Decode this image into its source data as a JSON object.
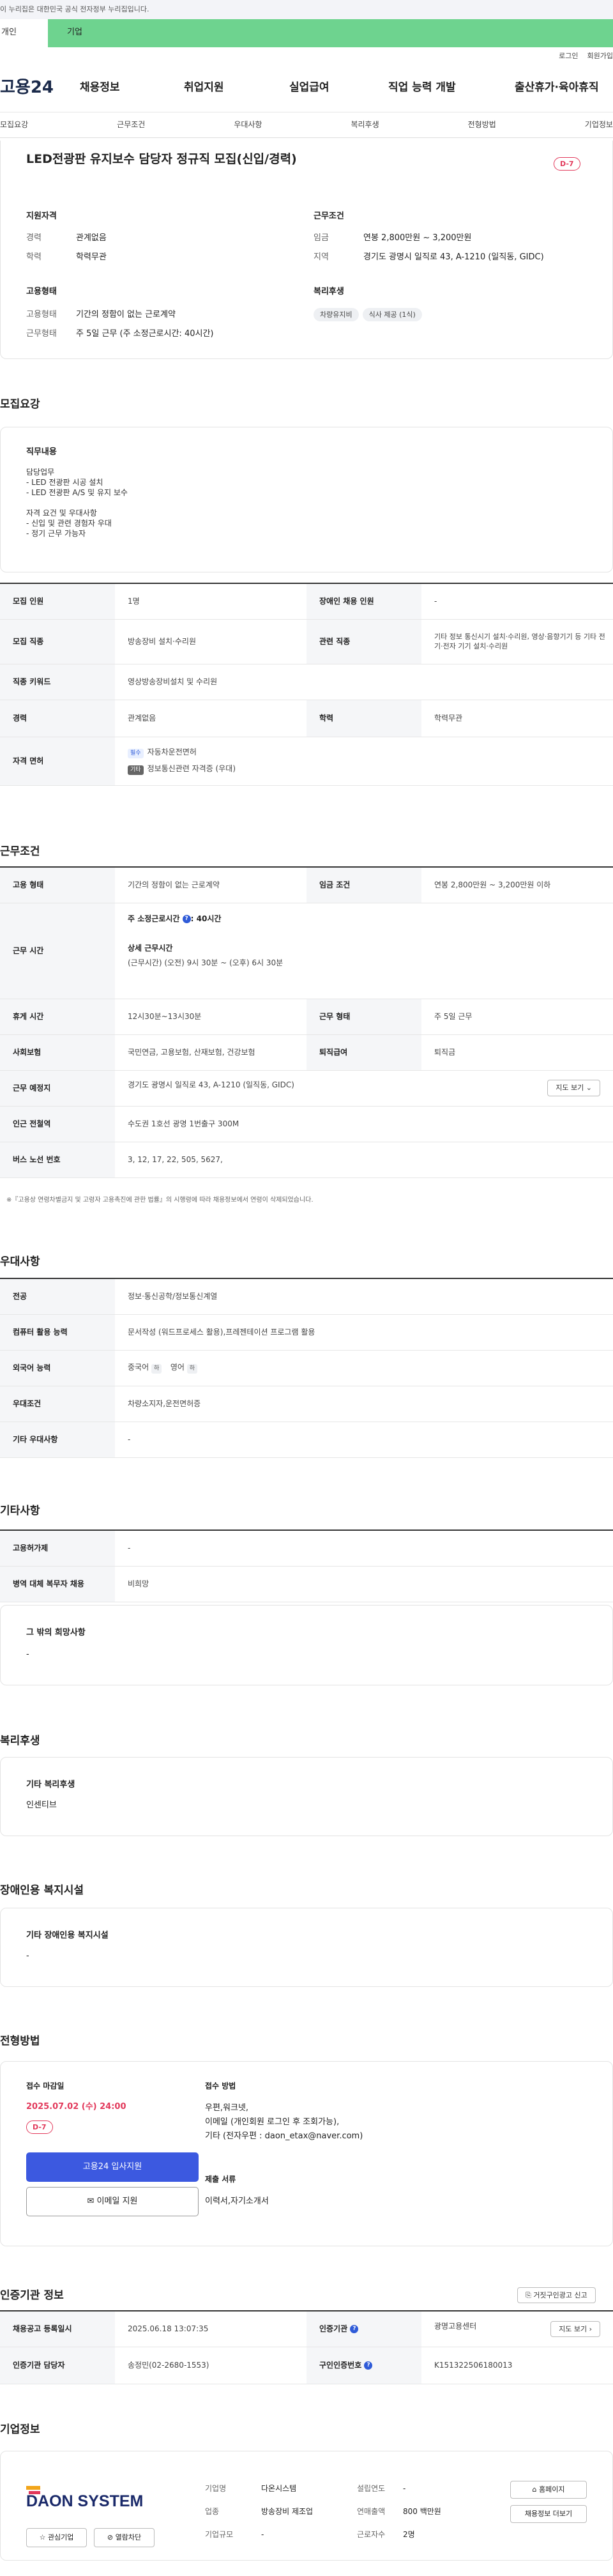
{
  "gov_banner": "이 누리집은 대한민국 공식 전자정부 누리집입니다.",
  "service_tabs": {
    "personal": "개인",
    "company": "기업"
  },
  "util": {
    "login": "로그인",
    "join": "회원가입"
  },
  "logo": "고용24",
  "gnb": [
    "채용정보",
    "취업지원",
    "실업급여",
    "직업 능력 개발",
    "출산휴가·육아휴직"
  ],
  "subtabs": [
    "모집요강",
    "근무조건",
    "우대사항",
    "복리후생",
    "전형방법",
    "기업정보"
  ],
  "summary": {
    "title": "LED전광판 유지보수 담당자 정규직 모집(신입/경력)",
    "dday": "D-7",
    "qual_h": "지원자격",
    "career_l": "경력",
    "career_v": "관계없음",
    "edu_l": "학력",
    "edu_v": "학력무관",
    "cond_h": "근무조건",
    "wage_l": "임금",
    "wage_v": "연봉 2,800만원 ~ 3,200만원",
    "region_l": "지역",
    "region_v": "경기도 광명시 일직로 43, A-1210 (일직동, GIDC)",
    "emp_h": "고용형태",
    "emptype_l": "고용형태",
    "emptype_v": "기간의 정함이 없는 근로계약",
    "worktype_l": "근무형태",
    "worktype_v": "주 5일 근무 (주 소정근로시간: 40시간)",
    "welfare_h": "복리후생",
    "welfare_tags": [
      "차량유지비",
      "식사 제공 (1식)"
    ]
  },
  "recruit": {
    "title": "모집요강",
    "duty_h": "직무내용",
    "duty_lines": [
      "담당업무",
      "- LED 전광판 시공 설치",
      "- LED 전광판  A/S 및 유지 보수",
      "",
      "자격 요건 및 우대사항",
      "- 신입 및 관련 경험자 우대",
      "- 정기 근무 가능자"
    ],
    "rows": {
      "count_l": "모집 인원",
      "count_v": "1명",
      "dis_l": "장애인 채용 인원",
      "dis_v": "-",
      "job_l": "모집 직종",
      "job_v": "방송장비 설치·수리원",
      "rel_l": "관련 직종",
      "rel_v": "기타 정보 통신시기 설치·수리원, 영상·음향기기 등 기타 전기·전자 기기 설치·수리원",
      "kw_l": "직종 키워드",
      "kw_v": "영상방송장비설치 및 수리원",
      "car_l": "경력",
      "car_v": "관계없음",
      "edu_l": "학력",
      "edu_v": "학력무관",
      "lic_l": "자격 면허",
      "lic": [
        {
          "chip": "필수",
          "v": "자동차운전면허"
        },
        {
          "chip": "기타",
          "v": "정보통신관련 자격증 (우대)"
        }
      ]
    }
  },
  "workcond": {
    "title": "근무조건",
    "emp_l": "고용 형태",
    "emp_v": "기간의 정함이 없는 근로계약",
    "wage_l": "임금 조건",
    "wage_v": "연봉 2,800만원 ~ 3,200만원 이하",
    "time_l": "근무 시간",
    "time_std": "주 소정근로시간",
    "time_std_v": ": 40시간",
    "time_detail_h": "상세 근무시간",
    "time_detail_v": "(근무시간) (오전) 9시 30분 ~ (오후) 6시 30분",
    "rest_l": "휴게 시간",
    "rest_v": "12시30분~13시30분",
    "form_l": "근무 형태",
    "form_v": "주 5일 근무",
    "ins_l": "사회보험",
    "ins_v": "국민연금, 고용보험, 산재보험, 건강보험",
    "sev_l": "퇴직급여",
    "sev_v": "퇴직금",
    "place_l": "근무 예정지",
    "place_v": "경기도 광명시 일직로 43, A-1210 (일직동, GIDC)",
    "map_btn": "지도 보기",
    "sub_l": "인근 전철역",
    "sub_v": "수도권 1호선 광명 1번출구 300M",
    "bus_l": "버스 노선 번호",
    "bus_v": "3, 12, 17, 22, 505, 5627,",
    "note": "※『고용상 연령차별금지 및 고령자 고용촉진에 관한 법률』의 시행령에 따라 채용정보에서 연령이 삭제되었습니다."
  },
  "pref": {
    "title": "우대사항",
    "major_l": "전공",
    "major_v": "정보·통신공학/정보통신계열",
    "pc_l": "컴퓨터 활용 능력",
    "pc_v": "문서작성 (워드프로세스 활용),프레젠테이션 프로그램 활용",
    "lang_l": "외국어 능력",
    "lang": [
      {
        "v": "중국어",
        "chip": "하"
      },
      {
        "v": "영어",
        "chip": "하"
      }
    ],
    "cond_l": "우대조건",
    "cond_v": "차량소지자,운전면허증",
    "etc_l": "기타 우대사항",
    "etc_v": "-"
  },
  "other": {
    "title": "기타사항",
    "hire_l": "고용허가제",
    "hire_v": "-",
    "mil_l": "병역 대체 복무자 채용",
    "mil_v": "비희망",
    "wish_h": "그 밖의 희망사항",
    "wish_v": "-"
  },
  "welfare": {
    "title": "복리후생",
    "h": "기타 복리후생",
    "v": "인센티브"
  },
  "disab": {
    "title": "장애인용 복지시설",
    "h": "기타 장애인용 복지시설",
    "v": "-"
  },
  "selection": {
    "title": "전형방법",
    "deadline_h": "접수 마감일",
    "deadline_v": "2025.07.02 (수) 24:00",
    "dday": "D-7",
    "apply_btn": "고용24 입사지원",
    "email_btn": "이메일 지원",
    "method_h": "접수 방법",
    "method_lines": [
      "우편,워크넷,",
      "이메일 (개인회원 로그인 후 조회가능),",
      "기타 (전자우편 : daon_etax@naver.com)"
    ],
    "docs_h": "제출 서류",
    "docs_v": "이력서,자기소개서"
  },
  "agency": {
    "title": "인증기관 정보",
    "report_btn": "거짓구인광고 신고",
    "reg_l": "채용공고 등록일시",
    "reg_v": "2025.06.18 13:07:35",
    "org_l": "인증기관",
    "org_v": "광명고용센터",
    "map_btn": "지도 보기",
    "mgr_l": "인증기관 담당자",
    "mgr_v": "송정민(02-2680-1553)",
    "no_l": "구인인증번호",
    "no_v": "K151322506180013"
  },
  "company": {
    "title": "기업정보",
    "logo_text": "DAON SYSTEM",
    "name_l": "기업명",
    "name_v": "다온시스템",
    "year_l": "설립연도",
    "year_v": "-",
    "ind_l": "업종",
    "ind_v": "방송장비 제조업",
    "sales_l": "연매출액",
    "sales_v": "800 백만원",
    "size_l": "기업규모",
    "size_v": "-",
    "emp_l": "근로자수",
    "emp_v": "2명",
    "home_btn": "홈페이지",
    "more_btn": "채용정보 더보기",
    "fav_btn": "관심기업",
    "wide_btn": "열람차단"
  },
  "colors": {
    "accent": "#2f5bd8",
    "green": "#6ed38f",
    "red": "#e2385a",
    "apply": "#3c59e0"
  }
}
